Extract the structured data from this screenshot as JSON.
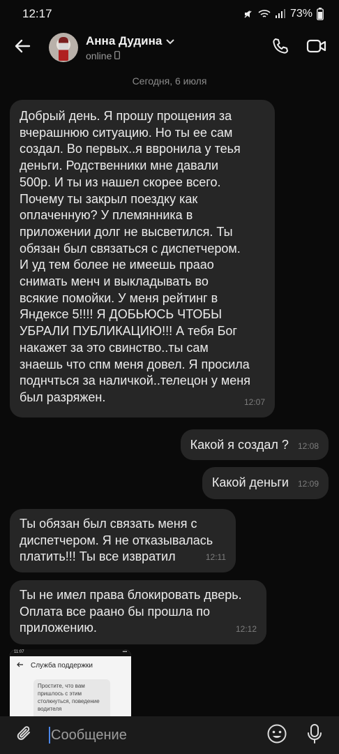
{
  "status_bar": {
    "time": "12:17",
    "battery": "73%",
    "icons": [
      "mute-icon",
      "wifi-icon",
      "signal-icon",
      "battery-icon"
    ]
  },
  "header": {
    "contact_name": "Анна Дудина",
    "presence": "online",
    "icons": [
      "back-arrow-icon",
      "chevron-down-icon",
      "phone-icon",
      "video-call-icon"
    ]
  },
  "date_separator": "Сегодня, 6 июля",
  "messages": [
    {
      "direction": "in",
      "lines": [
        "Добрый день. Я прошу прощения за",
        "вчерашнюю ситуацию. Но ты ее сам",
        "создал. Во первых..я вврoнила у теья",
        "деньги. Родственники мне давали",
        "500р.  И ты из нашел скорее всего.",
        "Почему ты закрыл поездку как",
        "оплаченную? У племянника в",
        "приложении долг не высветился. Ты",
        "обязан был связаться с диспетчером.",
        "И уд тем более не имеешь прaао",
        "снимать менч и выкладывать во",
        "всякие помойки. У меня рейтинг в",
        "Яндексе 5!!!! Я ДОБЬЮСЬ ЧТОБЫ",
        "УБРАЛИ ПУБЛИКАЦИЮ!!! А тебя Бог",
        "накажет за это свинство..ты сам",
        "знаешь что спм меня довел. Я просила",
        "поднчться за наличкой..телецон у меня",
        "был разряжен."
      ],
      "time": "12:07"
    },
    {
      "direction": "out",
      "text": "Какой я создал ?",
      "time": "12:08"
    },
    {
      "direction": "out",
      "text": "Какой деньги",
      "time": "12:09"
    },
    {
      "direction": "in",
      "lines": [
        "Ты обязан был связать меня с",
        "диспетчером. Я не отказывалась",
        "платить!!! Ты все извратил"
      ],
      "time": "12:11"
    },
    {
      "direction": "in",
      "lines": [
        "Ты не имел права блокировать дверь.",
        "Оплата все раано бы прошла по",
        "приложению."
      ],
      "time": "12:12"
    }
  ],
  "attachment": {
    "status_time": "11:07",
    "title": "Служба поддержки",
    "bubble_text": "Простите, что вам пришлось с этим столкнуться, поведение водителя"
  },
  "composer": {
    "placeholder": "Сообщение",
    "icons": [
      "paperclip-icon",
      "emoji-icon",
      "microphone-icon"
    ]
  },
  "colors": {
    "background": "#0a0a0a",
    "bubble": "#262626",
    "composer": "#1b1b1b",
    "caret": "#4a86e8"
  }
}
